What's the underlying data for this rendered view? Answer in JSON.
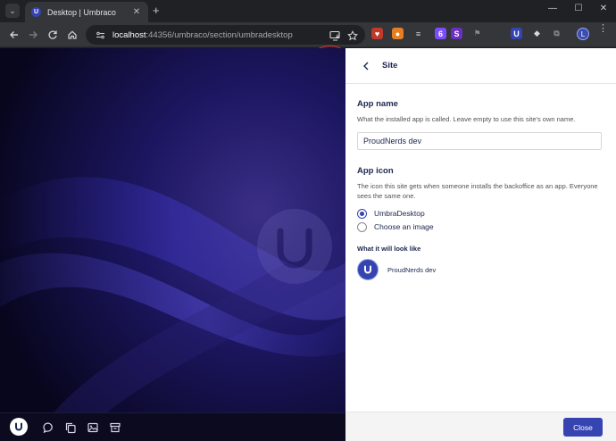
{
  "browser": {
    "tab_title": "Desktop | Umbraco",
    "tab_favicon_letter": "U",
    "tab_close_glyph": "✕",
    "new_tab_glyph": "+",
    "tab_list_glyph": "⌄",
    "window_controls": {
      "minimize": "—",
      "maximize": "☐",
      "close": "✕"
    },
    "url_host": "localhost",
    "url_path": ":44356/umbraco/section/umbradesktop",
    "nav_icons": [
      "back-arrow-icon",
      "forward-arrow-icon",
      "reload-icon",
      "home-icon"
    ],
    "extensions": [
      {
        "name": "heart-extension-icon",
        "color": "#c0392b",
        "glyph": "♥"
      },
      {
        "name": "fox-extension-icon",
        "color": "#e67e22",
        "glyph": "●"
      },
      {
        "name": "notes-extension-icon",
        "color": "#d8d8d8",
        "glyph": "≡"
      },
      {
        "name": "badge-extension-icon",
        "color": "#7c4dff",
        "glyph": "6"
      },
      {
        "name": "s-extension-icon",
        "color": "#6a2fbf",
        "glyph": "S"
      },
      {
        "name": "flag-extension-icon",
        "color": "#8a8a8a",
        "glyph": "⚑"
      },
      {
        "name": "umbraco-extension-icon",
        "color": "#3544b1",
        "glyph": "U"
      },
      {
        "name": "shield-extension-icon",
        "color": "#d8d8d8",
        "glyph": "◆"
      },
      {
        "name": "puzzle-extension-icon",
        "color": "#8a8a8a",
        "glyph": "⧉"
      },
      {
        "name": "sidepanel-extension-icon",
        "color": "#8a8a8a",
        "glyph": "▯"
      }
    ],
    "profile_letter": "L",
    "menu_glyph": "⋮"
  },
  "panel": {
    "title": "Site",
    "app_name": {
      "heading": "App name",
      "help": "What the installed app is called. Leave empty to use this site's own name.",
      "value": "ProudNerds dev"
    },
    "app_icon": {
      "heading": "App icon",
      "help": "The icon this site gets when someone installs the backoffice as an app. Everyone sees the same one.",
      "options": [
        {
          "label": "UmbraDesktop",
          "checked": true
        },
        {
          "label": "Choose an image",
          "checked": false
        }
      ]
    },
    "preview": {
      "heading": "What it will look like",
      "name": "ProudNerds dev"
    },
    "close_label": "Close"
  },
  "dock": {
    "items": [
      "umbraco-logo-icon",
      "chat-icon",
      "copy-icon",
      "image-icon",
      "archive-icon"
    ]
  },
  "colors": {
    "accent": "#3544b1",
    "backdrop": "#0c0a2e",
    "annotation": "#e0302a"
  }
}
